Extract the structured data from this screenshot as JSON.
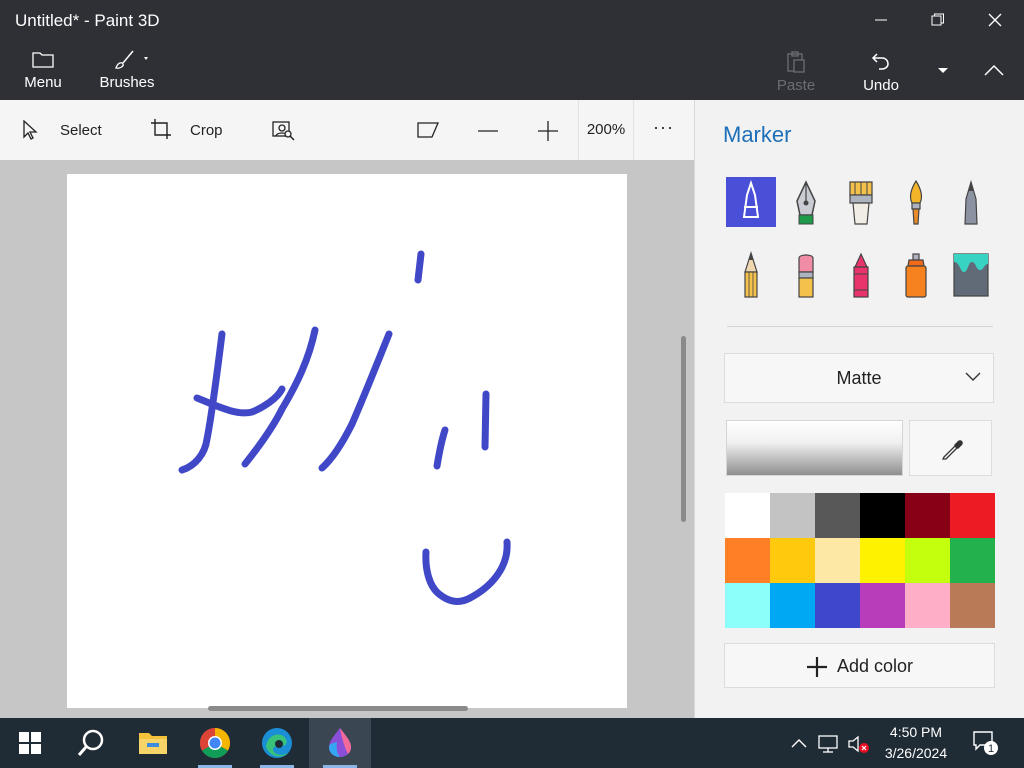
{
  "window": {
    "title": "Untitled* - Paint 3D"
  },
  "commandbar": {
    "menu_label": "Menu",
    "brushes_label": "Brushes",
    "paste_label": "Paste",
    "undo_label": "Undo"
  },
  "toolbar": {
    "select_label": "Select",
    "crop_label": "Crop",
    "zoom_value": "200%",
    "more_label": "···"
  },
  "panel": {
    "title": "Marker",
    "brushes": [
      "Marker",
      "Calligraphy pen",
      "Oil brush",
      "Watercolor",
      "Pixel pen",
      "Pencil",
      "Eraser",
      "Crayon",
      "Spray can",
      "Fill"
    ],
    "finish": "Matte",
    "palette": [
      "#ffffff",
      "#c3c3c3",
      "#585858",
      "#000000",
      "#880015",
      "#ed1c24",
      "#ff7f27",
      "#ffc90e",
      "#fde8a5",
      "#fff200",
      "#c4ff0e",
      "#22b14c",
      "#8cfffb",
      "#00a8f3",
      "#3f48cc",
      "#b83dba",
      "#ffaec8",
      "#b97a57"
    ],
    "add_color_label": "Add color"
  },
  "canvas": {
    "stroke_color": "#4048c8"
  },
  "taskbar": {
    "apps": [
      "start-icon",
      "search-icon",
      "file-explorer-icon",
      "chrome-icon",
      "edge-icon",
      "paint-3d-icon"
    ],
    "time": "4:50 PM",
    "date": "3/26/2024",
    "notification_count": "1"
  }
}
